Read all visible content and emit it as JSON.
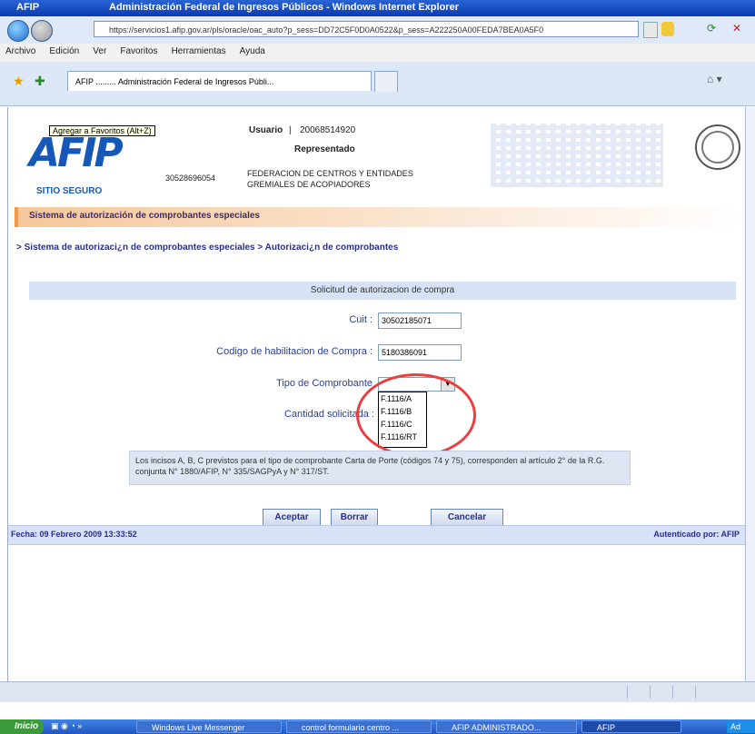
{
  "window": {
    "app_label": "AFIP",
    "title": "Administración Federal de Ingresos Públicos - Windows Internet Explorer"
  },
  "address_bar": {
    "url": "https://servicios1.afip.gov.ar/pls/oracle/oac_auto?p_sess=DD72C5F0D0A0522&p_sess=A222250A00FEDA7BEA0A5F0"
  },
  "menu": {
    "items": [
      "Archivo",
      "Edición",
      "Ver",
      "Favoritos",
      "Herramientas",
      "Ayuda"
    ]
  },
  "tab": {
    "label": "AFIP ......... Administración Federal de Ingresos Públi..."
  },
  "header": {
    "favorites_tooltip": "Agregar a Favoritos (Alt+Z)",
    "logo_text": "AFIP",
    "secure_text": "SITIO SEGURO",
    "usuario_label": "Usuario",
    "usuario_value": "20068514920",
    "representado_label": "Representado",
    "representado_cuit": "30528696054",
    "representado_name_line1": "FEDERACION DE CENTROS Y ENTIDADES",
    "representado_name_line2": "GREMIALES DE ACOPIADORES"
  },
  "section_title": "Sistema de autorización de comprobantes especiales",
  "breadcrumb": "> Sistema de autorizaci¿n de comprobantes especiales > Autorizaci¿n de comprobantes",
  "form": {
    "title": "Solicitud de autorizacion de compra",
    "cuit_label": "Cuit :",
    "cuit_value": "30502185071",
    "codigo_label": "Codigo de habilitacion de Compra :",
    "codigo_value": "5180386091",
    "tipo_label": "Tipo de Comprobante",
    "tipo_options": [
      "F.1116/A",
      "F.1116/B",
      "F.1116/C",
      "F.1116/RT"
    ],
    "cantidad_label": "Cantidad solicitada :",
    "note": "Los incisos A, B, C previstos para el tipo de comprobante Carta de Porte (códigos 74 y 75), corresponden al artículo 2° de la R.G. conjunta N° 1880/AFIP, N° 335/SAGPyA y N° 317/ST."
  },
  "buttons": {
    "accept": "Aceptar",
    "clear": "Borrar",
    "cancel": "Cancelar"
  },
  "footer": {
    "date": "Fecha: 09 Febrero 2009 13:33:52",
    "auth": "Autenticado por: AFIP"
  },
  "taskbar": {
    "start": "Inicio",
    "items": [
      "Windows Live Messenger",
      "control formulario centro ...",
      "AFIP ADMINISTRADO...",
      "AFIP"
    ],
    "clock": "Ad"
  }
}
